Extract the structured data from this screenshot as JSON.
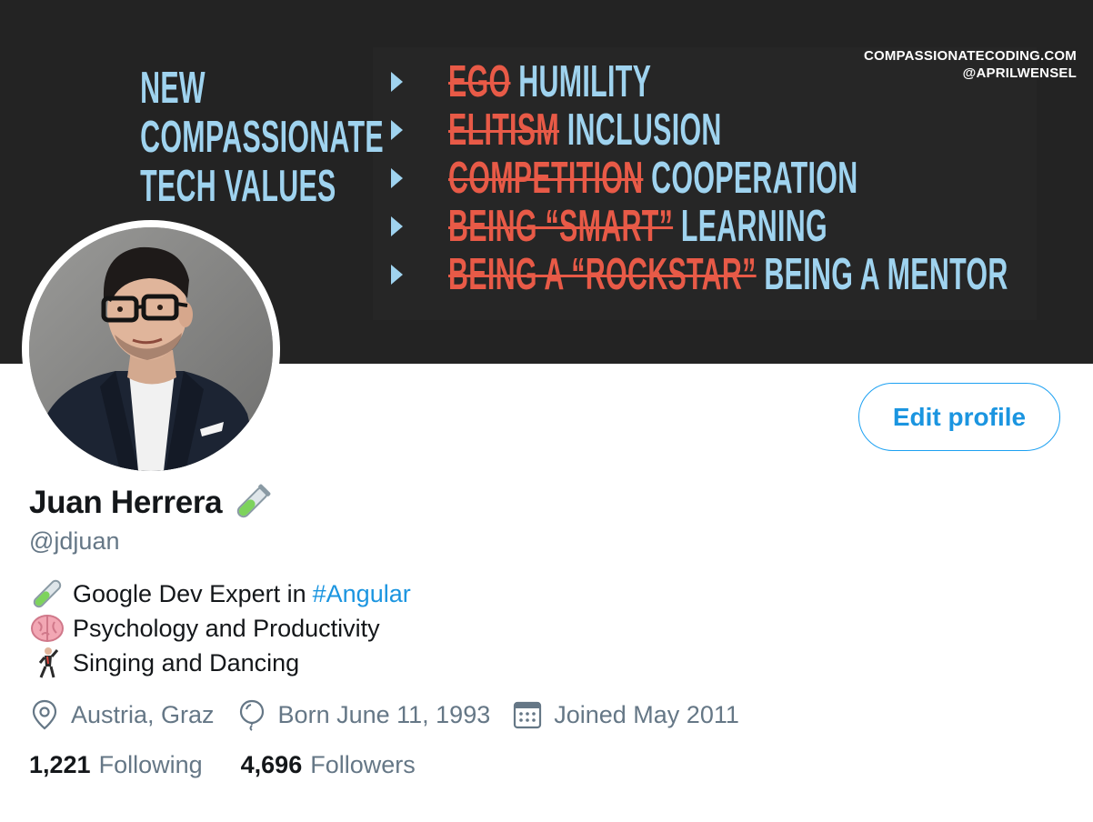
{
  "banner": {
    "title_lines": [
      "NEW",
      "COMPASSIONATE",
      "TECH VALUES"
    ],
    "values": [
      {
        "old": "EGO",
        "new": "HUMILITY"
      },
      {
        "old": "ELITISM",
        "new": "INCLUSION"
      },
      {
        "old": "COMPETITION",
        "new": "COOPERATION"
      },
      {
        "old": "BEING “SMART”",
        "new": "LEARNING"
      },
      {
        "old": "BEING A “ROCKSTAR”",
        "new": "BEING A MENTOR"
      }
    ],
    "credit_site": "COMPASSIONATECODING.COM",
    "credit_handle": "@APRILWENSEL"
  },
  "profile": {
    "name": "Juan Herrera",
    "name_emoji": "test-tube-icon",
    "handle": "@jdjuan",
    "edit_button_label": "Edit profile",
    "bio": [
      {
        "icon": "test-tube-icon",
        "text": "Google Dev Expert in",
        "hashtag": "#Angular"
      },
      {
        "icon": "brain-icon",
        "text": "Psychology and Productivity"
      },
      {
        "icon": "man-dancing-icon",
        "text": "Singing and Dancing"
      }
    ],
    "location": "Austria, Graz",
    "birthday": "Born June 11, 1993",
    "joined": "Joined May 2011"
  },
  "stats": {
    "following_count": "1,221",
    "following_label": "Following",
    "followers_count": "4,696",
    "followers_label": "Followers"
  },
  "colors": {
    "accent": "#1da1f2",
    "banner_bg": "#232323",
    "banner_blue": "#9fd3ef",
    "banner_red": "#e85a47",
    "secondary_text": "#657786"
  }
}
